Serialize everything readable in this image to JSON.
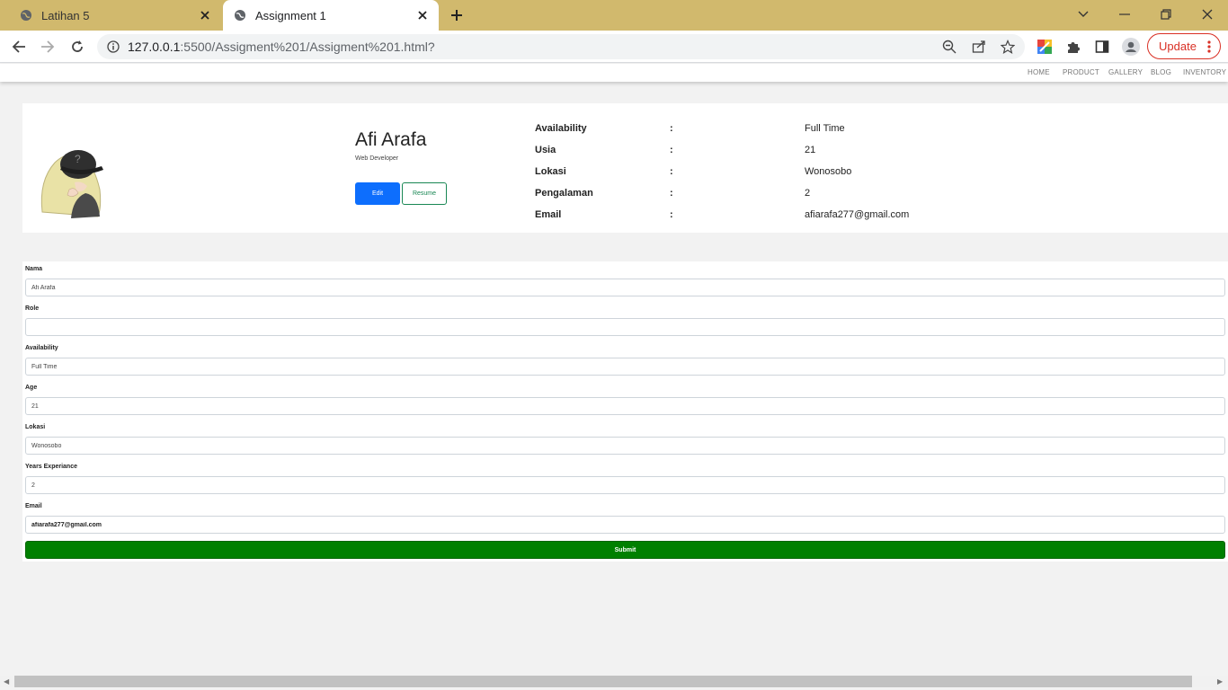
{
  "browser": {
    "tabs": [
      {
        "title": "Latihan 5",
        "active": false
      },
      {
        "title": "Assignment 1",
        "active": true
      }
    ],
    "url_host": "127.0.0.1",
    "url_rest": ":5500/Assigment%201/Assigment%201.html?",
    "update_label": "Update"
  },
  "nav": {
    "items": [
      "HOME",
      "PRODUCT",
      "GALLERY",
      "BLOG",
      "INVENTORY"
    ]
  },
  "profile": {
    "name": "Afi Arafa",
    "role": "Web Developer",
    "edit_label": "Edit",
    "resume_label": "Resume",
    "details": [
      {
        "label": "Availability",
        "sep": ":",
        "value": "Full Time"
      },
      {
        "label": "Usia",
        "sep": ":",
        "value": "21"
      },
      {
        "label": "Lokasi",
        "sep": ":",
        "value": "Wonosobo"
      },
      {
        "label": "Pengalaman",
        "sep": ":",
        "value": "2"
      },
      {
        "label": "Email",
        "sep": ":",
        "value": "afiarafa277@gmail.com"
      }
    ]
  },
  "form": {
    "fields": [
      {
        "label": "Nama",
        "value": "Afi Arafa"
      },
      {
        "label": "Role",
        "value": ""
      },
      {
        "label": "Availability",
        "value": "Full Time"
      },
      {
        "label": "Age",
        "value": "21"
      },
      {
        "label": "Lokasi",
        "value": "Wonosobo"
      },
      {
        "label": "Years Experiance",
        "value": "2"
      },
      {
        "label": "Email",
        "value": "afiarafa277@gmail.com"
      }
    ],
    "submit_label": "Submit"
  },
  "colors": {
    "tabbar": "#d1b96d",
    "edit_button": "#0d6efd",
    "resume_border": "#198754",
    "submit_button": "#008000",
    "update_button": "#d93025"
  },
  "icons": {
    "tab": "globe-icon",
    "close": "close-icon",
    "new_tab": "plus-icon",
    "back": "back-arrow-icon",
    "forward": "forward-arrow-icon",
    "reload": "reload-icon",
    "info": "info-icon",
    "zoom": "zoom-out-icon",
    "share": "share-icon",
    "bookmark": "star-icon",
    "extensions": "puzzle-icon",
    "side_panel": "side-panel-icon",
    "profile": "profile-icon"
  }
}
